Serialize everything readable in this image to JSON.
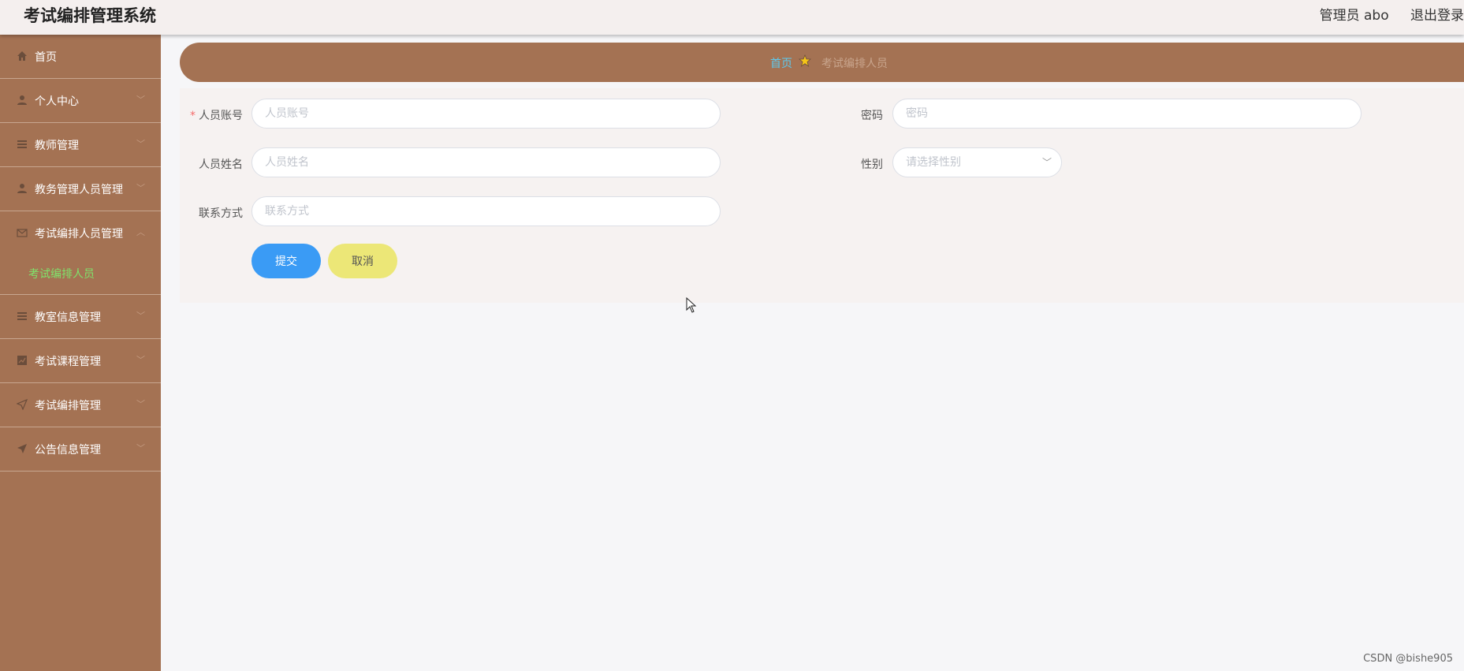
{
  "header": {
    "app_title": "考试编排管理系统",
    "user_label": "管理员 abo",
    "logout_label": "退出登录"
  },
  "sidebar": {
    "items": [
      {
        "label": "首页",
        "icon": "home-icon"
      },
      {
        "label": "个人中心",
        "icon": "user-icon"
      },
      {
        "label": "教师管理",
        "icon": "list-icon"
      },
      {
        "label": "教务管理人员管理",
        "icon": "user-icon"
      },
      {
        "label": "考试编排人员管理",
        "icon": "mail-icon",
        "expanded": true
      },
      {
        "label": "教室信息管理",
        "icon": "list-icon"
      },
      {
        "label": "考试课程管理",
        "icon": "chart-icon"
      },
      {
        "label": "考试编排管理",
        "icon": "send-icon"
      },
      {
        "label": "公告信息管理",
        "icon": "plane-icon"
      }
    ],
    "submenu": {
      "label": "考试编排人员",
      "active_color": "#7fe36b"
    }
  },
  "breadcrumb": {
    "home": "首页",
    "current": "考试编排人员"
  },
  "form": {
    "account": {
      "label": "人员账号",
      "placeholder": "人员账号",
      "required": true
    },
    "password": {
      "label": "密码",
      "placeholder": "密码"
    },
    "name": {
      "label": "人员姓名",
      "placeholder": "人员姓名"
    },
    "gender": {
      "label": "性别",
      "placeholder": "请选择性别"
    },
    "contact": {
      "label": "联系方式",
      "placeholder": "联系方式"
    },
    "submit_label": "提交",
    "cancel_label": "取消"
  },
  "colors": {
    "sidebar_bg": "#a47253",
    "submit_bg": "#3a9bf5",
    "cancel_bg": "#ece777",
    "breadcrumb_home": "#5ec9ee"
  },
  "watermark": "CSDN @bishe905"
}
